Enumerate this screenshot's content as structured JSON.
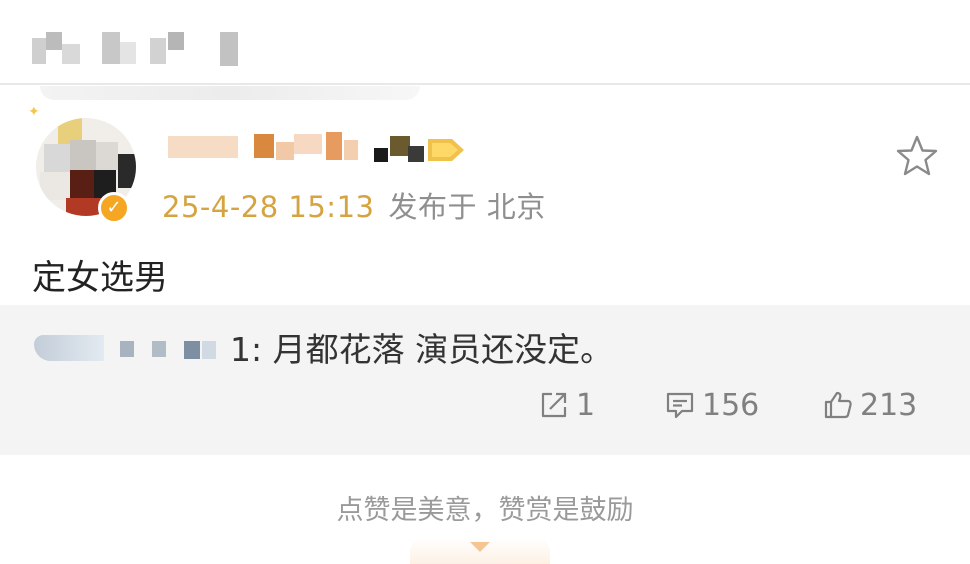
{
  "post": {
    "timestamp": "25-4-28 15:13",
    "location": "发布于 北京",
    "text": "定女选男"
  },
  "reply": {
    "text": "1: 月都花落  演员还没定。"
  },
  "actions": {
    "repost_count": "1",
    "comment_count": "156",
    "like_count": "213"
  },
  "footer": {
    "text": "点赞是美意，赞赏是鼓励"
  },
  "icons": {
    "favorite": "star-icon",
    "repost": "repost-icon",
    "comment": "comment-icon",
    "like": "thumbs-up-icon",
    "verified": "verified-badge-icon"
  },
  "colors": {
    "timestamp": "#d5a440",
    "location": "#8f8f8f",
    "verified": "#f5a623",
    "reply_background": "#f4f4f4",
    "action_gray": "#808080"
  }
}
